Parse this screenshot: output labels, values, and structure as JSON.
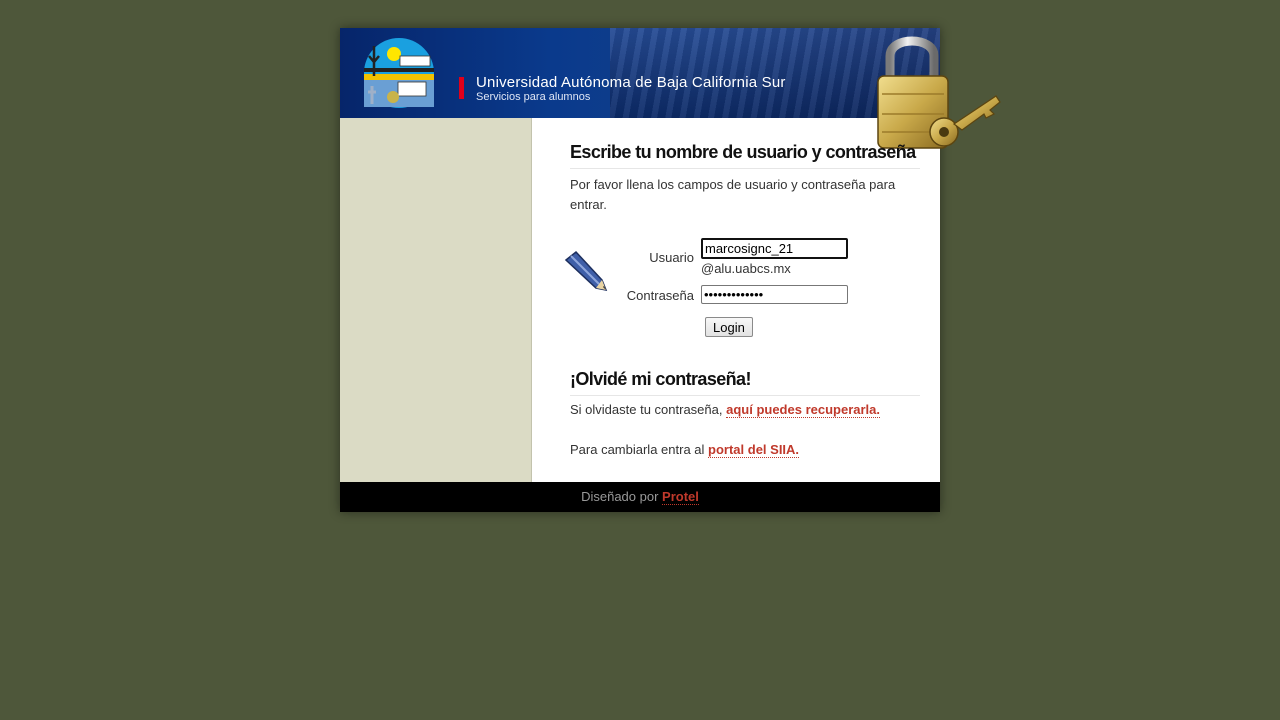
{
  "header": {
    "university_name": "Universidad Autónoma de Baja California Sur",
    "subtitle": "Servicios para alumnos",
    "logo_icon": "uabcs-logo-icon",
    "lock_icon": "padlock-key-icon"
  },
  "login": {
    "heading": "Escribe tu nombre de usuario y contraseña",
    "intro": "Por favor llena los campos de usuario y contraseña para entrar.",
    "pencil_icon": "pencil-icon",
    "username_label": "Usuario",
    "username_value": "marcosignc_21",
    "domain_suffix": "@alu.uabcs.mx",
    "password_label": "Contraseña",
    "password_value": "•••••••••••••",
    "login_button": "Login"
  },
  "forgot": {
    "heading": "¡Olvidé mi contraseña!",
    "text_prefix": "Si olvidaste tu contraseña,",
    "recover_link": "aquí puedes recuperarla.",
    "change_prefix": "Para cambiarla entra al",
    "portal_link": "portal del SIIA."
  },
  "footer": {
    "designed_by": "Diseñado por",
    "designer_link": "Protel"
  },
  "colors": {
    "page_background": "#4e573a",
    "header_blue": "#0a3a8c",
    "sidebar": "#dbdbc5",
    "link": "#c0392b",
    "accent_red": "#e0001a"
  }
}
